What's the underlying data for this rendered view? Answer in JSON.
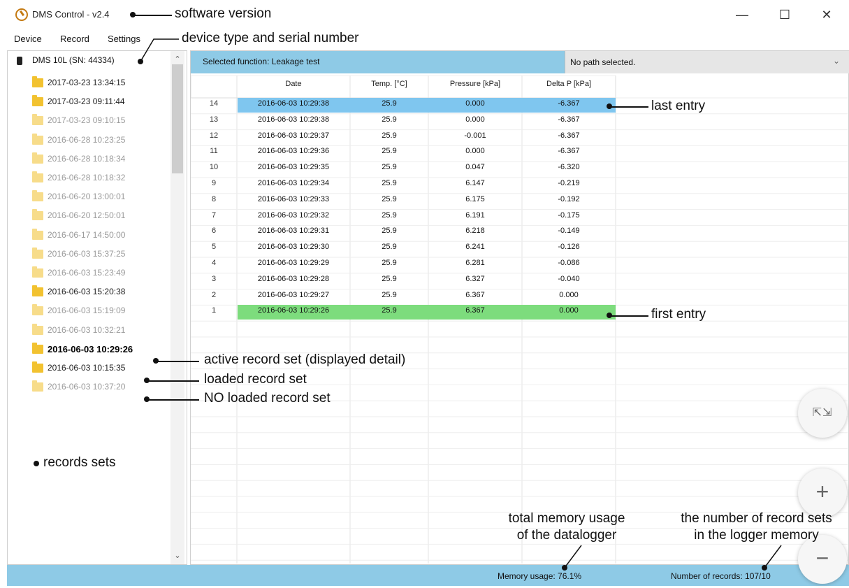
{
  "window": {
    "title": "DMS Control - v2.4",
    "minimize_icon": "minimize-icon",
    "maximize_icon": "maximize-icon",
    "close_icon": "close-icon"
  },
  "menu": [
    "Device",
    "Record",
    "Settings"
  ],
  "device": {
    "label": "DMS 10L (SN: 44334)",
    "icon": "device-icon"
  },
  "records": [
    {
      "label": "2017-03-23 13:34:15",
      "state": "loaded"
    },
    {
      "label": "2017-03-23 09:11:44",
      "state": "loaded"
    },
    {
      "label": "2017-03-23 09:10:15",
      "state": "unloaded"
    },
    {
      "label": "2016-06-28 10:23:25",
      "state": "unloaded"
    },
    {
      "label": "2016-06-28 10:18:34",
      "state": "unloaded"
    },
    {
      "label": "2016-06-28 10:18:32",
      "state": "unloaded"
    },
    {
      "label": "2016-06-20 13:00:01",
      "state": "unloaded"
    },
    {
      "label": "2016-06-20 12:50:01",
      "state": "unloaded"
    },
    {
      "label": "2016-06-17 14:50:00",
      "state": "unloaded"
    },
    {
      "label": "2016-06-03 15:37:25",
      "state": "unloaded"
    },
    {
      "label": "2016-06-03 15:23:49",
      "state": "unloaded"
    },
    {
      "label": "2016-06-03 15:20:38",
      "state": "loaded"
    },
    {
      "label": "2016-06-03 15:19:09",
      "state": "unloaded"
    },
    {
      "label": "2016-06-03 10:32:21",
      "state": "unloaded"
    },
    {
      "label": "2016-06-03 10:29:26",
      "state": "active"
    },
    {
      "label": "2016-06-03 10:15:35",
      "state": "loaded"
    },
    {
      "label": "2016-06-03 10:37:20",
      "state": "unloaded"
    }
  ],
  "function_bar": {
    "selected_function": "Selected function: Leakage test",
    "path": "No path selected."
  },
  "table": {
    "headers": [
      "Date",
      "Temp. [°C]",
      "Pressure [kPa]",
      "Delta P [kPa]"
    ],
    "rows": [
      {
        "n": "14",
        "date": "2016-06-03 10:29:38",
        "temp": "25.9",
        "pressure": "0.000",
        "delta": "-6.367",
        "highlight": "last"
      },
      {
        "n": "13",
        "date": "2016-06-03 10:29:38",
        "temp": "25.9",
        "pressure": "0.000",
        "delta": "-6.367"
      },
      {
        "n": "12",
        "date": "2016-06-03 10:29:37",
        "temp": "25.9",
        "pressure": "-0.001",
        "delta": "-6.367"
      },
      {
        "n": "11",
        "date": "2016-06-03 10:29:36",
        "temp": "25.9",
        "pressure": "0.000",
        "delta": "-6.367"
      },
      {
        "n": "10",
        "date": "2016-06-03 10:29:35",
        "temp": "25.9",
        "pressure": "0.047",
        "delta": "-6.320"
      },
      {
        "n": "9",
        "date": "2016-06-03 10:29:34",
        "temp": "25.9",
        "pressure": "6.147",
        "delta": "-0.219"
      },
      {
        "n": "8",
        "date": "2016-06-03 10:29:33",
        "temp": "25.9",
        "pressure": "6.175",
        "delta": "-0.192"
      },
      {
        "n": "7",
        "date": "2016-06-03 10:29:32",
        "temp": "25.9",
        "pressure": "6.191",
        "delta": "-0.175"
      },
      {
        "n": "6",
        "date": "2016-06-03 10:29:31",
        "temp": "25.9",
        "pressure": "6.218",
        "delta": "-0.149"
      },
      {
        "n": "5",
        "date": "2016-06-03 10:29:30",
        "temp": "25.9",
        "pressure": "6.241",
        "delta": "-0.126"
      },
      {
        "n": "4",
        "date": "2016-06-03 10:29:29",
        "temp": "25.9",
        "pressure": "6.281",
        "delta": "-0.086"
      },
      {
        "n": "3",
        "date": "2016-06-03 10:29:28",
        "temp": "25.9",
        "pressure": "6.327",
        "delta": "-0.040"
      },
      {
        "n": "2",
        "date": "2016-06-03 10:29:27",
        "temp": "25.9",
        "pressure": "6.367",
        "delta": "0.000"
      },
      {
        "n": "1",
        "date": "2016-06-03 10:29:26",
        "temp": "25.9",
        "pressure": "6.367",
        "delta": "0.000",
        "highlight": "first"
      }
    ]
  },
  "status": {
    "memory": "Memory usage: 76.1%",
    "records": "Number of records: 107/10"
  },
  "fabs": {
    "collapse_icon": "collapse-icon",
    "zoom_in_icon": "plus-icon",
    "zoom_out_icon": "minus-icon"
  },
  "annotations": {
    "software_version": "software version",
    "device_type": "device type and serial number",
    "last_entry": "last entry",
    "first_entry": "first entry",
    "active_set": "active record set (displayed detail)",
    "loaded_set": "loaded record set",
    "no_loaded_set": "NO loaded record set",
    "records_sets": "records sets",
    "memory_line1": "total memory usage",
    "memory_line2": "of the datalogger",
    "num_line1": "the number of record sets",
    "num_line2": "in the logger memory"
  },
  "colors": {
    "accent_blue": "#8ecae6",
    "last_entry_highlight": "#7fc6ef",
    "first_entry_highlight": "#7ddc7d",
    "folder": "#f2c230"
  }
}
